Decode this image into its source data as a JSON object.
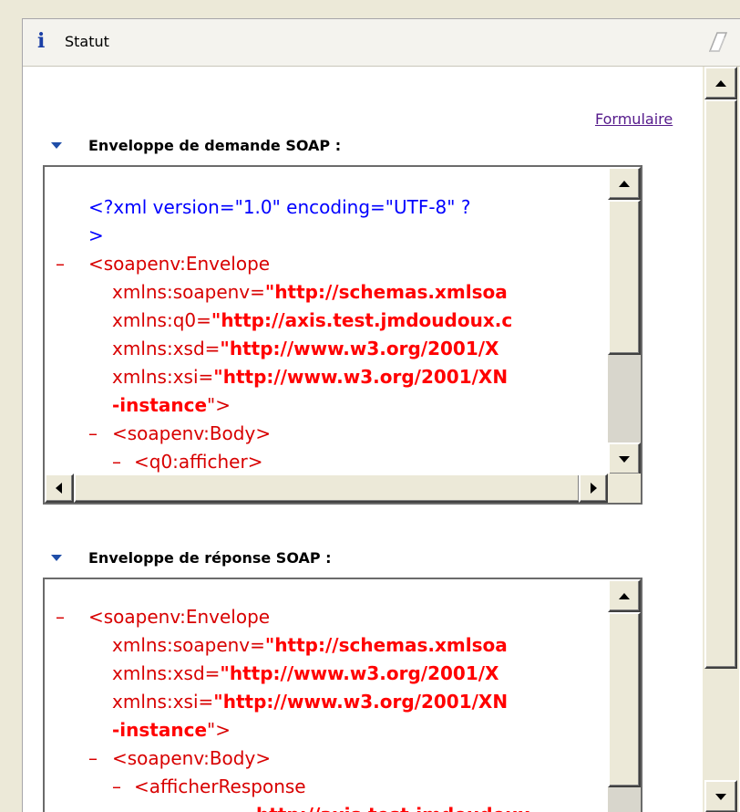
{
  "header": {
    "title": "Statut",
    "info_icon": "info-icon",
    "clear_icon": "eraser-icon"
  },
  "form_link": "Formulaire",
  "request": {
    "heading": "Enveloppe de demande SOAP :",
    "xml_decl_1": "<?xml version=\"1.0\" encoding=\"UTF-8\" ?",
    "xml_decl_2": ">",
    "envelope_open": "<soapenv:Envelope",
    "attrs": [
      {
        "name": "xmlns:soapenv=",
        "value": "http://schemas.xmlsoa"
      },
      {
        "name": "xmlns:q0=",
        "value": "http://axis.test.jmdoudoux.c"
      },
      {
        "name": "xmlns:xsd=",
        "value": "http://www.w3.org/2001/X"
      },
      {
        "name": "xmlns:xsi=",
        "value": "http://www.w3.org/2001/XN"
      }
    ],
    "instance": "-instance",
    "instance_close": "\">",
    "body_open": "<soapenv:Body>",
    "child_open": "<q0:afficher>"
  },
  "response": {
    "heading": "Enveloppe de réponse SOAP :",
    "envelope_open": "<soapenv:Envelope",
    "attrs": [
      {
        "name": "xmlns:soapenv=",
        "value": "http://schemas.xmlsoa"
      },
      {
        "name": "xmlns:xsd=",
        "value": "http://www.w3.org/2001/X"
      },
      {
        "name": "xmlns:xsi=",
        "value": "http://www.w3.org/2001/XN"
      }
    ],
    "instance": "-instance",
    "instance_close": "\">",
    "body_open": "<soapenv:Body>",
    "child_open": "<afficherResponse",
    "cut_line": "http://axis.test.jmdoudoux"
  },
  "quote": "\"",
  "collapse_marker": "–"
}
